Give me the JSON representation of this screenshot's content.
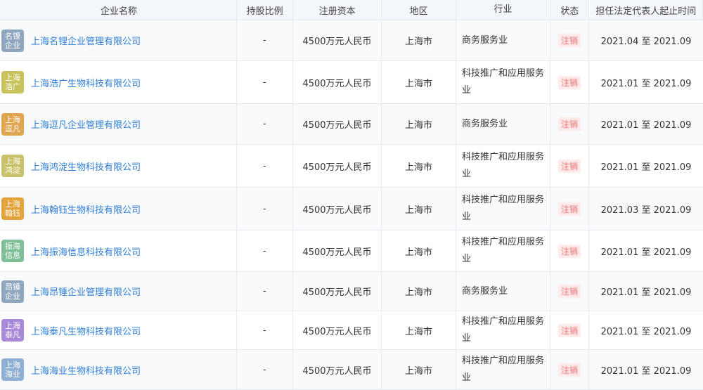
{
  "columns": {
    "name": "企业名称",
    "share": "持股比例",
    "capital": "注册资本",
    "region": "地区",
    "industry": "行业",
    "status": "状态",
    "tenure": "担任法定代表人起止时间"
  },
  "rows": [
    {
      "logo": "名锂企业",
      "logo_color": "#8ea7bf",
      "name": "上海名锂企业管理有限公司",
      "share": "-",
      "capital": "4500万元人民币",
      "region": "上海市",
      "industry": "商务服务业",
      "status": "注销",
      "tenure": "2021.04 至 2021.09"
    },
    {
      "logo": "上海浩广",
      "logo_color": "#c7c25b",
      "name": "上海浩广生物科技有限公司",
      "share": "-",
      "capital": "4500万元人民币",
      "region": "上海市",
      "industry": "科技推广和应用服务业",
      "status": "注销",
      "tenure": "2021.01 至 2021.09"
    },
    {
      "logo": "上海逗凡",
      "logo_color": "#e0a64d",
      "name": "上海逗凡企业管理有限公司",
      "share": "-",
      "capital": "4500万元人民币",
      "region": "上海市",
      "industry": "商务服务业",
      "status": "注销",
      "tenure": "2021.01 至 2021.09"
    },
    {
      "logo": "上海鸿淀",
      "logo_color": "#c9c26a",
      "name": "上海鸿淀生物科技有限公司",
      "share": "-",
      "capital": "4500万元人民币",
      "region": "上海市",
      "industry": "科技推广和应用服务业",
      "status": "注销",
      "tenure": "2021.01 至 2021.09"
    },
    {
      "logo": "上海翰钰",
      "logo_color": "#e3a23a",
      "name": "上海翰钰生物科技有限公司",
      "share": "-",
      "capital": "4500万元人民币",
      "region": "上海市",
      "industry": "科技推广和应用服务业",
      "status": "注销",
      "tenure": "2021.03 至 2021.09"
    },
    {
      "logo": "振海信息",
      "logo_color": "#7fbf98",
      "name": "上海振海信息科技有限公司",
      "share": "-",
      "capital": "4500万元人民币",
      "region": "上海市",
      "industry": "科技推广和应用服务业",
      "status": "注销",
      "tenure": "2021.01 至 2021.09"
    },
    {
      "logo": "昂锤企业",
      "logo_color": "#8ea7bf",
      "name": "上海昂锤企业管理有限公司",
      "share": "-",
      "capital": "4500万元人民币",
      "region": "上海市",
      "industry": "商务服务业",
      "status": "注销",
      "tenure": "2021.01 至 2021.09"
    },
    {
      "logo": "上海泰凡",
      "logo_color": "#a889d9",
      "name": "上海泰凡生物科技有限公司",
      "share": "-",
      "capital": "4500万元人民币",
      "region": "上海市",
      "industry": "科技推广和应用服务业",
      "status": "注销",
      "tenure": "2021.01 至 2021.09"
    },
    {
      "logo": "上海海业",
      "logo_color": "#8fb0d4",
      "name": "上海海业生物科技有限公司",
      "share": "-",
      "capital": "4500万元人民币",
      "region": "上海市",
      "industry": "科技推广和应用服务业",
      "status": "注销",
      "tenure": "2021.01 至 2021.09"
    }
  ]
}
